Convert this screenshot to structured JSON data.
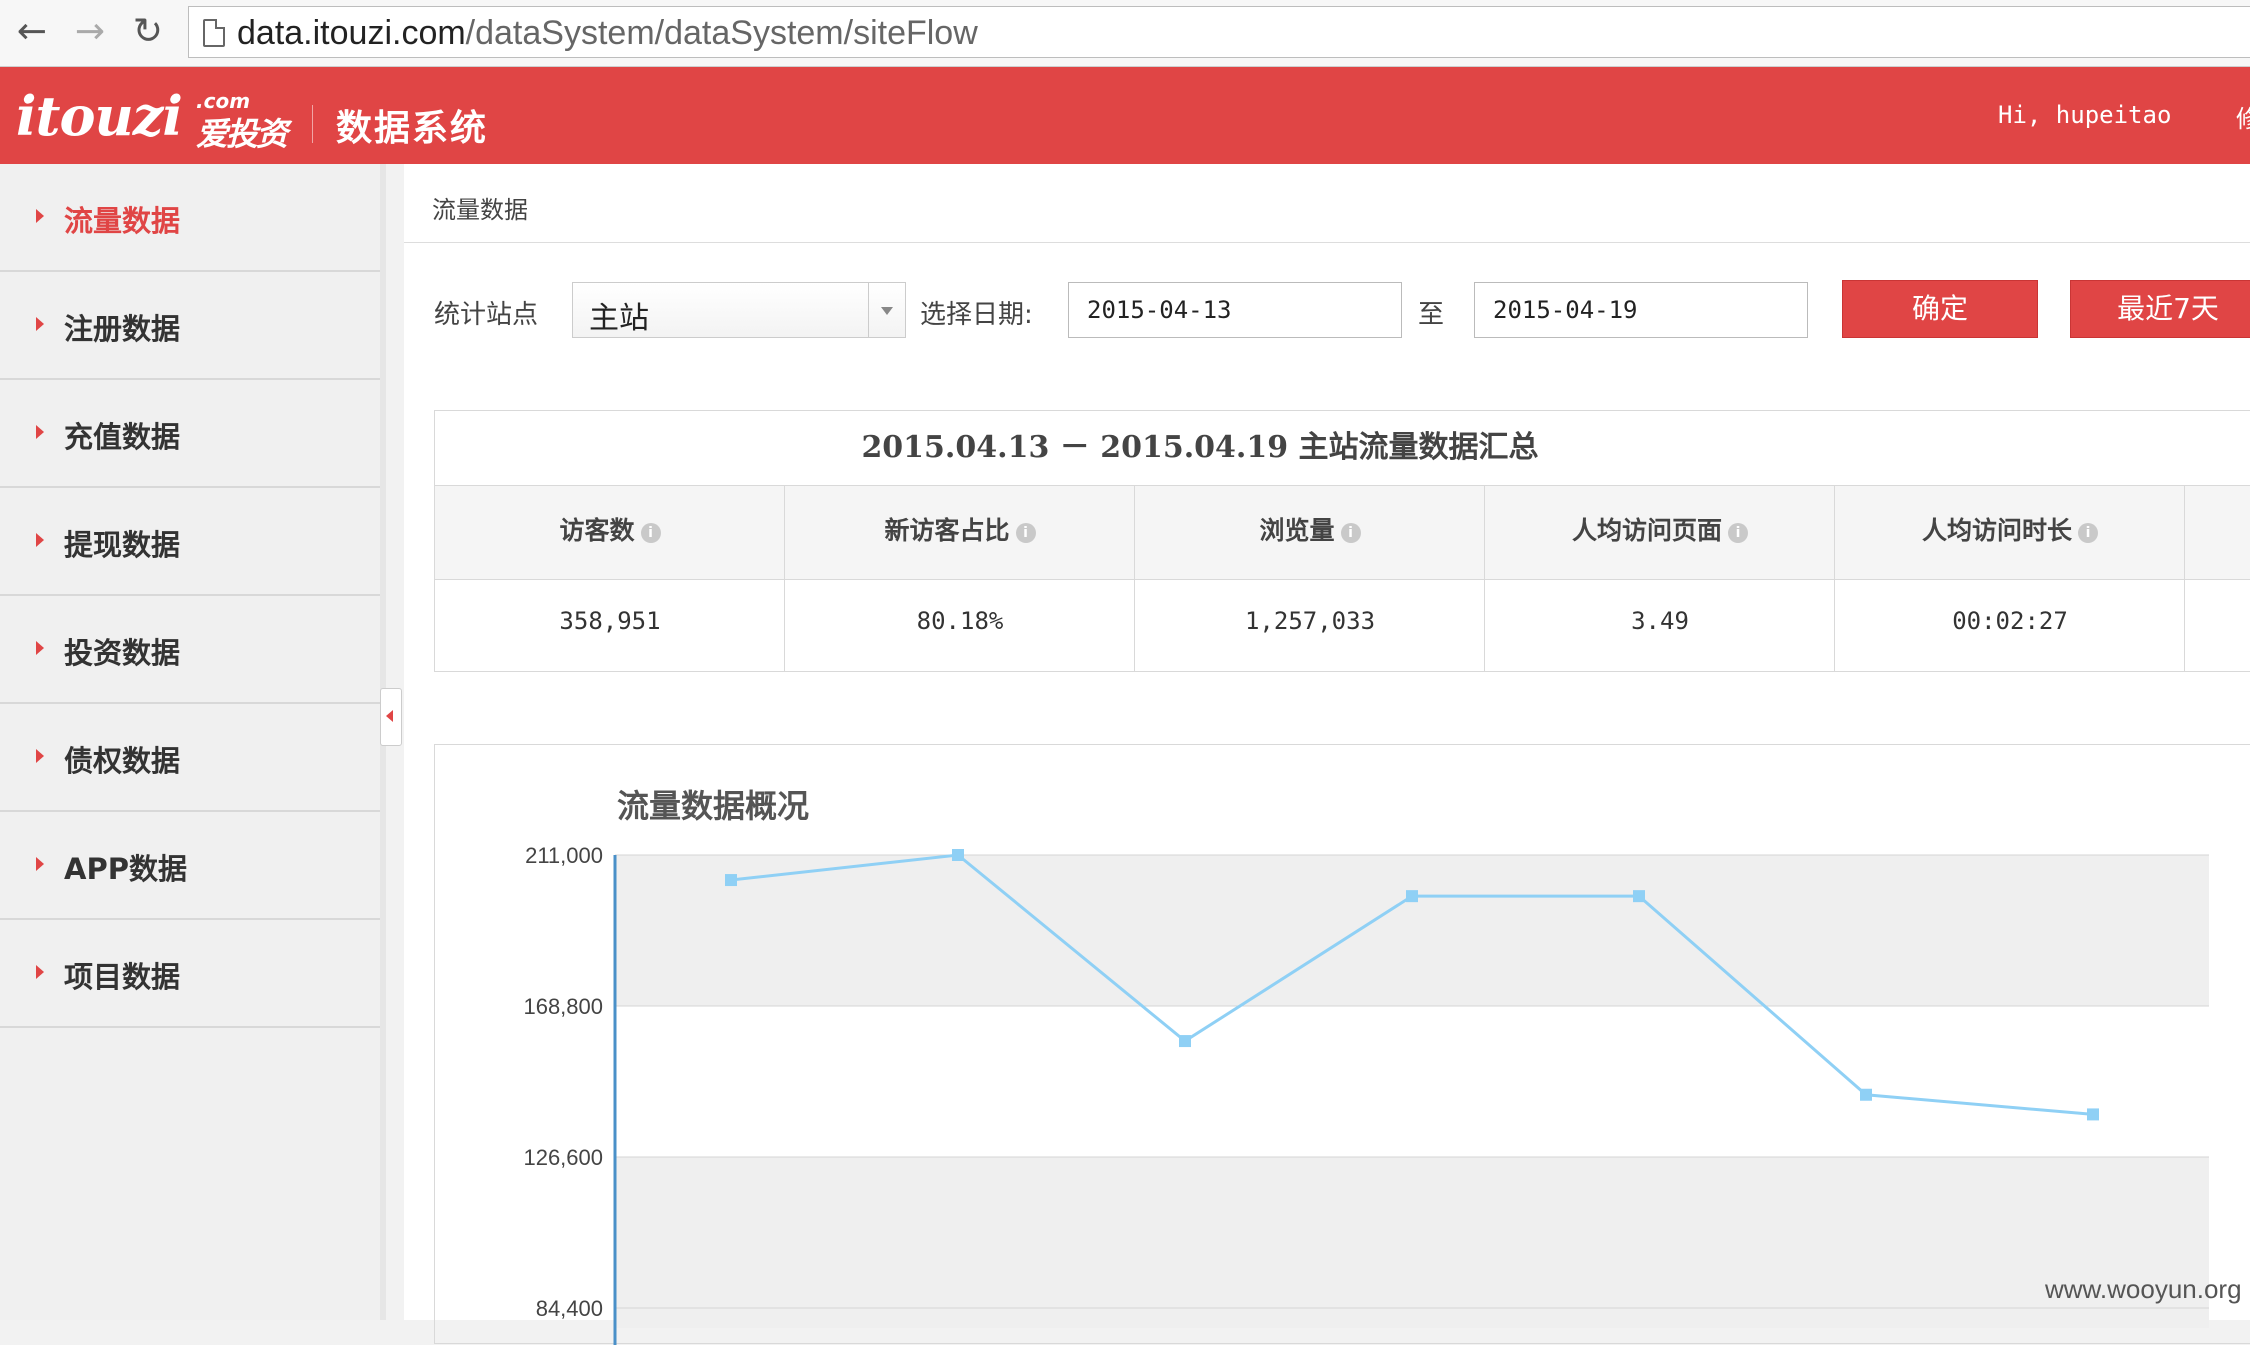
{
  "browser": {
    "url_host": "data.itouzi.com",
    "url_path": "/dataSystem/dataSystem/siteFlow"
  },
  "header": {
    "logo_text": "itouzi",
    "logo_com": ".com",
    "logo_cn": "爱投资",
    "system_title": "数据系统",
    "greeting": "Hi, hupeitao",
    "cut_text": "修"
  },
  "sidebar": {
    "items": [
      {
        "label": "流量数据",
        "active": true
      },
      {
        "label": "注册数据"
      },
      {
        "label": "充值数据"
      },
      {
        "label": "提现数据"
      },
      {
        "label": "投资数据"
      },
      {
        "label": "债权数据"
      },
      {
        "label": "APP数据"
      },
      {
        "label": "项目数据"
      }
    ]
  },
  "main": {
    "breadcrumb": "流量数据",
    "filters": {
      "site_label": "统计站点",
      "site_value": "主站",
      "date_label": "选择日期:",
      "date_from": "2015-04-13",
      "to_label": "至",
      "date_to": "2015-04-19",
      "confirm_button": "确定",
      "last7_button": "最近7天"
    },
    "summary": {
      "title": "2015.04.13 － 2015.04.19 主站流量数据汇总",
      "columns": [
        {
          "header": "访客数",
          "value": "358,951"
        },
        {
          "header": "新访客占比",
          "value": "80.18%"
        },
        {
          "header": "浏览量",
          "value": "1,257,033"
        },
        {
          "header": "人均访问页面",
          "value": "3.49"
        },
        {
          "header": "人均访问时长",
          "value": "00:02:27"
        }
      ]
    }
  },
  "chart_data": {
    "type": "line",
    "title": "流量数据概况",
    "yticks": [
      "211,000",
      "168,800",
      "126,600",
      "84,400"
    ],
    "ylim": [
      84400,
      211000
    ],
    "x": [
      1,
      2,
      3,
      4,
      5,
      6,
      7
    ],
    "series": [
      {
        "values": [
          204000,
          211000,
          159000,
          199500,
          199500,
          144000,
          138500
        ],
        "color": "#8fd0f5"
      }
    ],
    "grid": true
  },
  "watermark": "www.wooyun.org"
}
